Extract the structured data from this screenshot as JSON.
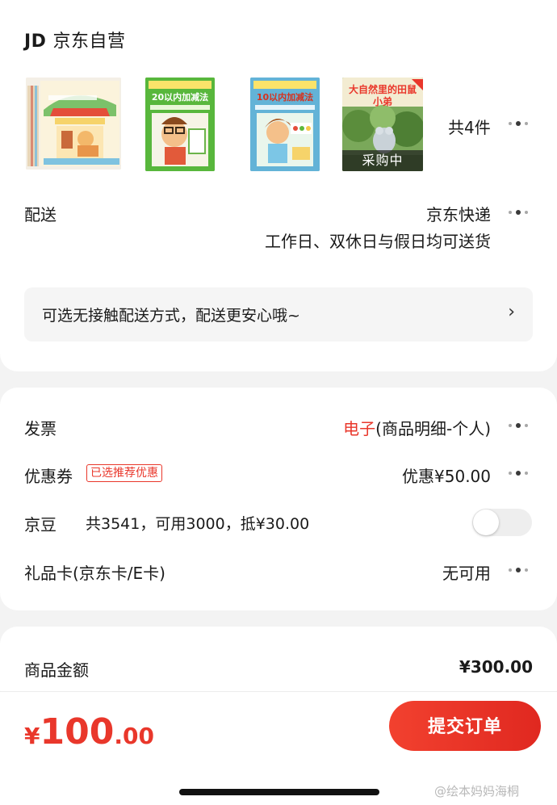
{
  "shop": {
    "logo_text": "JD",
    "name": "京东自营"
  },
  "products": {
    "items": [
      {
        "cover": "story-book-box-set",
        "title": "",
        "color": "#e8b860"
      },
      {
        "cover": "math-workbook-20",
        "title": "20以内加减法",
        "color": "#5cb83c"
      },
      {
        "cover": "math-workbook-10",
        "title": "10以内加减法",
        "color": "#65b4d8"
      },
      {
        "cover": "picture-book-field-mouse",
        "title": "大自然里的田鼠小弟",
        "color": "#6a9a4a"
      }
    ],
    "purchasing_tag": "采购中",
    "count_label": "共4件"
  },
  "delivery": {
    "label": "配送",
    "carrier": "京东快递",
    "schedule": "工作日、双休日与假日均可送货"
  },
  "contactless_tip": {
    "text": "可选无接触配送方式，配送更安心哦~",
    "arrow": "›"
  },
  "invoice": {
    "label": "发票",
    "type_highlight": "电子",
    "type_detail": "(商品明细-个人)"
  },
  "coupon": {
    "label": "优惠券",
    "badge": "已选推荐优惠",
    "value": "优惠¥50.00"
  },
  "jingdou": {
    "label": "京豆",
    "detail": "共3541，可用3000，抵¥30.00",
    "toggle_on": false
  },
  "gift_card": {
    "label": "礼品卡(京东卡/E卡)",
    "value": "无可用"
  },
  "amount": {
    "label": "商品金额",
    "value": "¥300.00"
  },
  "footer": {
    "currency": "¥",
    "total_int": "100",
    "total_dec": ".00",
    "submit_label": "提交订单",
    "watermark": "@绘本妈妈海桐"
  },
  "colors": {
    "accent_red": "#e9372b",
    "background": "#f3f3f3",
    "card": "#ffffff"
  }
}
